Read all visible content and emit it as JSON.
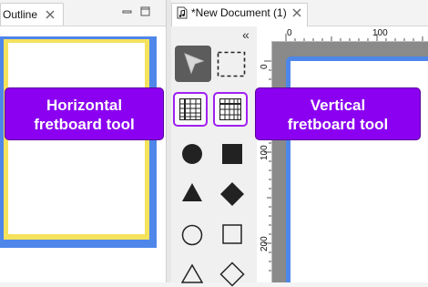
{
  "outline": {
    "tab_label": "Outline"
  },
  "editor": {
    "tab_label": "*New Document (1)"
  },
  "palette": {
    "collapse_glyph": "«",
    "tools": [
      {
        "name": "select-tool",
        "icon": "arrow-pointer-icon"
      },
      {
        "name": "marquee-tool",
        "icon": "marquee-icon"
      },
      {
        "name": "horizontal-fretboard-tool",
        "icon": "horizontal-fretboard-icon"
      },
      {
        "name": "vertical-fretboard-tool",
        "icon": "vertical-fretboard-icon"
      },
      {
        "name": "filled-circle-tool",
        "icon": "filled-circle-icon"
      },
      {
        "name": "filled-square-tool",
        "icon": "filled-square-icon"
      },
      {
        "name": "filled-triangle-tool",
        "icon": "filled-triangle-icon"
      },
      {
        "name": "filled-diamond-tool",
        "icon": "filled-diamond-icon"
      },
      {
        "name": "outline-circle-tool",
        "icon": "outline-circle-icon"
      },
      {
        "name": "outline-square-tool",
        "icon": "outline-square-icon"
      },
      {
        "name": "outline-triangle-tool",
        "icon": "outline-triangle-icon"
      },
      {
        "name": "outline-diamond-tool",
        "icon": "outline-diamond-icon"
      }
    ]
  },
  "ruler": {
    "top_labels": [
      "0",
      "100"
    ],
    "left_labels": [
      "0",
      "100",
      "200"
    ]
  },
  "callouts": {
    "horizontal_line1": "Horizontal",
    "horizontal_line2": "fretboard tool",
    "vertical_line1": "Vertical",
    "vertical_line2": "fretboard tool"
  },
  "colors": {
    "accent_purple": "#8b00f0",
    "page_blue": "#4e86ea",
    "outline_yellow": "#f5e25c"
  }
}
